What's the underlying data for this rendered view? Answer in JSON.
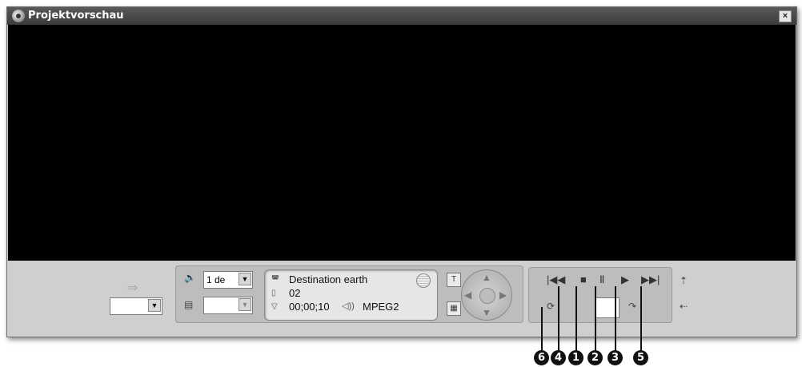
{
  "window": {
    "title": "Projektvorschau",
    "close_label": "×"
  },
  "left_controls": {
    "output_dropdown_value": ""
  },
  "audio_panel": {
    "volume_icon": "speaker-icon",
    "language_value": "1 de",
    "subtitle_value": ""
  },
  "info": {
    "title_line": "Destination earth",
    "chapter_line": "02",
    "time_line": "00;00;10",
    "audio_line": "MPEG2"
  },
  "transport": {
    "first_label": "|◀◀",
    "stop_label": "■",
    "pause_label": "Ⅱ",
    "play_label": "▶",
    "last_label": "▶▶|",
    "frame_value": ""
  },
  "callouts": [
    "6",
    "4",
    "1",
    "2",
    "3",
    "5"
  ]
}
